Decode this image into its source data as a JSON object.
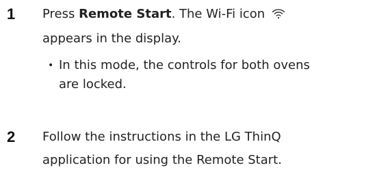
{
  "steps": [
    {
      "number": "1",
      "text_before": "Press ",
      "bold_text": "Remote Start",
      "text_after": ". The Wi-Fi icon",
      "icon": "wifi-icon",
      "line2": "appears in the display.",
      "bullets": [
        {
          "marker": "•",
          "line1": "In this mode, the controls for both ovens",
          "line2": "are locked."
        }
      ]
    },
    {
      "number": "2",
      "line1": "Follow the instructions in the LG ThinQ",
      "line2": "application for using the Remote Start."
    }
  ]
}
